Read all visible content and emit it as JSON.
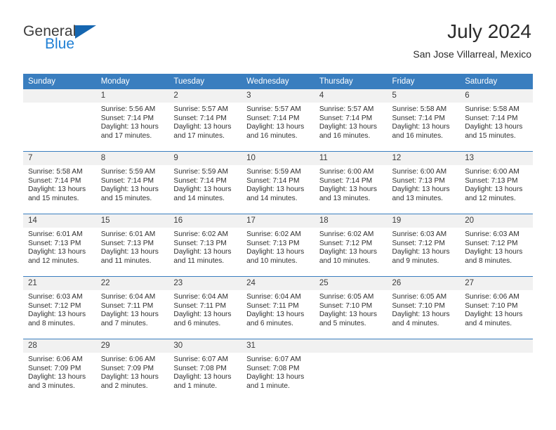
{
  "brand": {
    "name_dark": "General",
    "name_blue": "Blue",
    "triangle_color": "#1566b0",
    "blue_color": "#1f7fd4"
  },
  "header": {
    "title": "July 2024",
    "subtitle": "San Jose Villarreal, Mexico"
  },
  "theme": {
    "header_bg": "#3a7ebf",
    "header_text": "#ffffff",
    "daynum_bg": "#f1f1f1",
    "row_divider": "#3a7ebf",
    "body_text": "#2f2f2f"
  },
  "weekdays": [
    "Sunday",
    "Monday",
    "Tuesday",
    "Wednesday",
    "Thursday",
    "Friday",
    "Saturday"
  ],
  "weeks": [
    [
      {
        "day": "",
        "empty": true,
        "sunrise": "",
        "sunset": "",
        "daylight1": "",
        "daylight2": ""
      },
      {
        "day": "1",
        "sunrise": "Sunrise: 5:56 AM",
        "sunset": "Sunset: 7:14 PM",
        "daylight1": "Daylight: 13 hours",
        "daylight2": "and 17 minutes."
      },
      {
        "day": "2",
        "sunrise": "Sunrise: 5:57 AM",
        "sunset": "Sunset: 7:14 PM",
        "daylight1": "Daylight: 13 hours",
        "daylight2": "and 17 minutes."
      },
      {
        "day": "3",
        "sunrise": "Sunrise: 5:57 AM",
        "sunset": "Sunset: 7:14 PM",
        "daylight1": "Daylight: 13 hours",
        "daylight2": "and 16 minutes."
      },
      {
        "day": "4",
        "sunrise": "Sunrise: 5:57 AM",
        "sunset": "Sunset: 7:14 PM",
        "daylight1": "Daylight: 13 hours",
        "daylight2": "and 16 minutes."
      },
      {
        "day": "5",
        "sunrise": "Sunrise: 5:58 AM",
        "sunset": "Sunset: 7:14 PM",
        "daylight1": "Daylight: 13 hours",
        "daylight2": "and 16 minutes."
      },
      {
        "day": "6",
        "sunrise": "Sunrise: 5:58 AM",
        "sunset": "Sunset: 7:14 PM",
        "daylight1": "Daylight: 13 hours",
        "daylight2": "and 15 minutes."
      }
    ],
    [
      {
        "day": "7",
        "sunrise": "Sunrise: 5:58 AM",
        "sunset": "Sunset: 7:14 PM",
        "daylight1": "Daylight: 13 hours",
        "daylight2": "and 15 minutes."
      },
      {
        "day": "8",
        "sunrise": "Sunrise: 5:59 AM",
        "sunset": "Sunset: 7:14 PM",
        "daylight1": "Daylight: 13 hours",
        "daylight2": "and 15 minutes."
      },
      {
        "day": "9",
        "sunrise": "Sunrise: 5:59 AM",
        "sunset": "Sunset: 7:14 PM",
        "daylight1": "Daylight: 13 hours",
        "daylight2": "and 14 minutes."
      },
      {
        "day": "10",
        "sunrise": "Sunrise: 5:59 AM",
        "sunset": "Sunset: 7:14 PM",
        "daylight1": "Daylight: 13 hours",
        "daylight2": "and 14 minutes."
      },
      {
        "day": "11",
        "sunrise": "Sunrise: 6:00 AM",
        "sunset": "Sunset: 7:14 PM",
        "daylight1": "Daylight: 13 hours",
        "daylight2": "and 13 minutes."
      },
      {
        "day": "12",
        "sunrise": "Sunrise: 6:00 AM",
        "sunset": "Sunset: 7:13 PM",
        "daylight1": "Daylight: 13 hours",
        "daylight2": "and 13 minutes."
      },
      {
        "day": "13",
        "sunrise": "Sunrise: 6:00 AM",
        "sunset": "Sunset: 7:13 PM",
        "daylight1": "Daylight: 13 hours",
        "daylight2": "and 12 minutes."
      }
    ],
    [
      {
        "day": "14",
        "sunrise": "Sunrise: 6:01 AM",
        "sunset": "Sunset: 7:13 PM",
        "daylight1": "Daylight: 13 hours",
        "daylight2": "and 12 minutes."
      },
      {
        "day": "15",
        "sunrise": "Sunrise: 6:01 AM",
        "sunset": "Sunset: 7:13 PM",
        "daylight1": "Daylight: 13 hours",
        "daylight2": "and 11 minutes."
      },
      {
        "day": "16",
        "sunrise": "Sunrise: 6:02 AM",
        "sunset": "Sunset: 7:13 PM",
        "daylight1": "Daylight: 13 hours",
        "daylight2": "and 11 minutes."
      },
      {
        "day": "17",
        "sunrise": "Sunrise: 6:02 AM",
        "sunset": "Sunset: 7:13 PM",
        "daylight1": "Daylight: 13 hours",
        "daylight2": "and 10 minutes."
      },
      {
        "day": "18",
        "sunrise": "Sunrise: 6:02 AM",
        "sunset": "Sunset: 7:12 PM",
        "daylight1": "Daylight: 13 hours",
        "daylight2": "and 10 minutes."
      },
      {
        "day": "19",
        "sunrise": "Sunrise: 6:03 AM",
        "sunset": "Sunset: 7:12 PM",
        "daylight1": "Daylight: 13 hours",
        "daylight2": "and 9 minutes."
      },
      {
        "day": "20",
        "sunrise": "Sunrise: 6:03 AM",
        "sunset": "Sunset: 7:12 PM",
        "daylight1": "Daylight: 13 hours",
        "daylight2": "and 8 minutes."
      }
    ],
    [
      {
        "day": "21",
        "sunrise": "Sunrise: 6:03 AM",
        "sunset": "Sunset: 7:12 PM",
        "daylight1": "Daylight: 13 hours",
        "daylight2": "and 8 minutes."
      },
      {
        "day": "22",
        "sunrise": "Sunrise: 6:04 AM",
        "sunset": "Sunset: 7:11 PM",
        "daylight1": "Daylight: 13 hours",
        "daylight2": "and 7 minutes."
      },
      {
        "day": "23",
        "sunrise": "Sunrise: 6:04 AM",
        "sunset": "Sunset: 7:11 PM",
        "daylight1": "Daylight: 13 hours",
        "daylight2": "and 6 minutes."
      },
      {
        "day": "24",
        "sunrise": "Sunrise: 6:04 AM",
        "sunset": "Sunset: 7:11 PM",
        "daylight1": "Daylight: 13 hours",
        "daylight2": "and 6 minutes."
      },
      {
        "day": "25",
        "sunrise": "Sunrise: 6:05 AM",
        "sunset": "Sunset: 7:10 PM",
        "daylight1": "Daylight: 13 hours",
        "daylight2": "and 5 minutes."
      },
      {
        "day": "26",
        "sunrise": "Sunrise: 6:05 AM",
        "sunset": "Sunset: 7:10 PM",
        "daylight1": "Daylight: 13 hours",
        "daylight2": "and 4 minutes."
      },
      {
        "day": "27",
        "sunrise": "Sunrise: 6:06 AM",
        "sunset": "Sunset: 7:10 PM",
        "daylight1": "Daylight: 13 hours",
        "daylight2": "and 4 minutes."
      }
    ],
    [
      {
        "day": "28",
        "sunrise": "Sunrise: 6:06 AM",
        "sunset": "Sunset: 7:09 PM",
        "daylight1": "Daylight: 13 hours",
        "daylight2": "and 3 minutes."
      },
      {
        "day": "29",
        "sunrise": "Sunrise: 6:06 AM",
        "sunset": "Sunset: 7:09 PM",
        "daylight1": "Daylight: 13 hours",
        "daylight2": "and 2 minutes."
      },
      {
        "day": "30",
        "sunrise": "Sunrise: 6:07 AM",
        "sunset": "Sunset: 7:08 PM",
        "daylight1": "Daylight: 13 hours",
        "daylight2": "and 1 minute."
      },
      {
        "day": "31",
        "sunrise": "Sunrise: 6:07 AM",
        "sunset": "Sunset: 7:08 PM",
        "daylight1": "Daylight: 13 hours",
        "daylight2": "and 1 minute."
      },
      {
        "day": "",
        "empty": true,
        "sunrise": "",
        "sunset": "",
        "daylight1": "",
        "daylight2": ""
      },
      {
        "day": "",
        "empty": true,
        "sunrise": "",
        "sunset": "",
        "daylight1": "",
        "daylight2": ""
      },
      {
        "day": "",
        "empty": true,
        "sunrise": "",
        "sunset": "",
        "daylight1": "",
        "daylight2": ""
      }
    ]
  ]
}
